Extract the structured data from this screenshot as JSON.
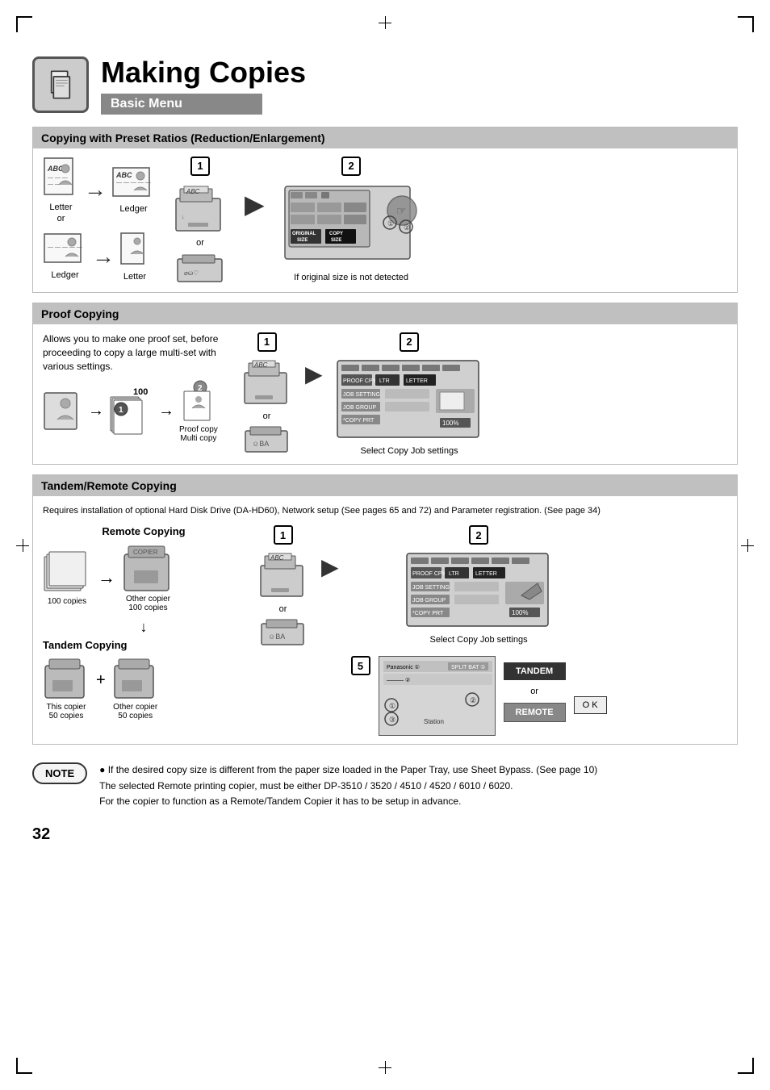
{
  "page": {
    "title": "Making Copies",
    "subtitle": "Basic Menu",
    "page_number": "32"
  },
  "sections": {
    "preset_ratios": {
      "header": "Copying with Preset Ratios (Reduction/Enlargement)",
      "labels": {
        "letter": "Letter",
        "or": "or",
        "ledger_left": "Ledger",
        "ledger_bottom": "Ledger",
        "letter_bottom": "Letter",
        "original_size": "ORIGINAL SIZE",
        "copy_size": "COPY SIZE",
        "if_text": "If original size is not detected",
        "step1": "1",
        "step2": "2"
      }
    },
    "proof_copying": {
      "header": "Proof Copying",
      "description": "Allows you to make one proof set, before proceeding to copy a large multi-set with various settings.",
      "labels": {
        "proof_copy": "Proof copy",
        "multi_copy": "Multi copy",
        "num_100": "100",
        "num_1": "1",
        "num_2": "2",
        "select_settings": "Select Copy Job settings",
        "step1": "1",
        "step2": "2",
        "or": "or"
      }
    },
    "tandem_remote": {
      "header": "Tandem/Remote Copying",
      "description": "Requires installation of optional Hard Disk Drive (DA-HD60), Network setup (See pages 65 and 72) and Parameter registration. (See page 34)",
      "remote_copying_label": "Remote Copying",
      "other_copier": "Other copier",
      "copies_100": "100 copies",
      "copies_100_right": "100 copies",
      "tandem_copying": "Tandem Copying",
      "this_copier": "This copier",
      "other_copier_2": "Other copier",
      "copies_50_left": "50 copies",
      "copies_50_right": "50 copies",
      "station": "Station",
      "select_settings": "Select Copy Job settings",
      "step1": "1",
      "step2": "2",
      "step5": "5",
      "tandem_btn": "TANDEM",
      "or": "or",
      "remote_btn": "REMOTE",
      "ok_btn": "O K"
    },
    "note": {
      "badge": "NOTE",
      "bullet1": "● If the desired copy size is different from the paper size loaded in the Paper Tray, use Sheet Bypass. (See page 10)",
      "line2": "The selected Remote printing copier, must be either DP-3510 / 3520 / 4510 / 4520 / 6010 / 6020.",
      "line3": "For the copier to function as a Remote/Tandem Copier it has to be setup in advance."
    }
  }
}
